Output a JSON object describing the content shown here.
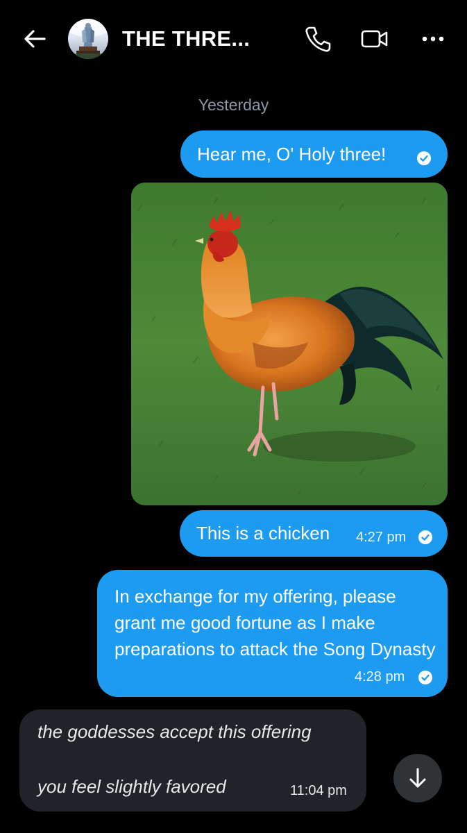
{
  "header": {
    "title": "THE THRE...",
    "back_icon": "arrow-left-icon",
    "call_icon": "phone-icon",
    "video_icon": "video-camera-icon",
    "more_icon": "more-horizontal-icon"
  },
  "conversation": {
    "date_separator": "Yesterday",
    "messages": [
      {
        "text": "Hear me, O' Holy three!",
        "time": "",
        "status_icon": "sent-check-icon"
      },
      {
        "type": "image",
        "description_icon": "rooster-photo"
      },
      {
        "text": "This is a chicken",
        "time": "4:27 pm",
        "status_icon": "sent-check-icon"
      },
      {
        "text": "In exchange for my offering, please grant me good fortune as I make preparations to attack the Song Dynasty",
        "time": "4:28 pm",
        "status_icon": "sent-check-icon"
      },
      {
        "line1": "the goddesses accept this offering",
        "line2": "you feel slightly favored",
        "time": "11:04 pm"
      }
    ]
  },
  "scroll_button_icon": "arrow-down-icon",
  "colors": {
    "accent": "#1d9bf0",
    "background": "#000000",
    "received_bubble": "#202327",
    "muted_text": "#8b98a5"
  }
}
